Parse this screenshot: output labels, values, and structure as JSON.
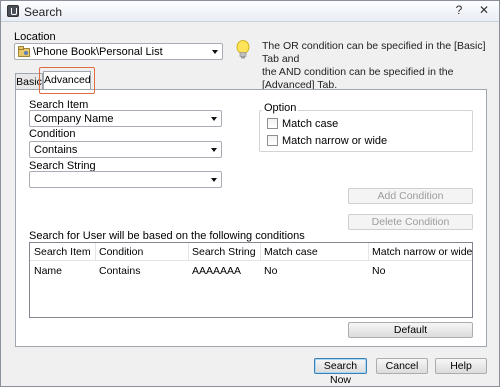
{
  "window": {
    "title": "Search"
  },
  "location": {
    "label": "Location",
    "value": "\\Phone Book\\Personal List",
    "info": [
      "The OR condition can be specified in the [Basic] Tab and",
      "the AND condition can be specified in the [Advanced] Tab."
    ]
  },
  "tabs": [
    {
      "label": "Basic"
    },
    {
      "label": "Advanced"
    }
  ],
  "advanced": {
    "search_item_label": "Search Item",
    "search_item_value": "Company Name",
    "condition_label": "Condition",
    "condition_value": "Contains",
    "search_string_label": "Search String",
    "search_string_value": "",
    "option_label": "Option",
    "match_case_label": "Match case",
    "match_narrow_label": "Match narrow or wide",
    "add_condition": "Add Condition",
    "delete_condition": "Delete Condition",
    "conditions_caption": "Search for User will be based on the following conditions",
    "columns": [
      "Search Item",
      "Condition",
      "Search String",
      "Match case",
      "Match narrow or wide"
    ],
    "rows": [
      [
        "Name",
        "Contains",
        "AAAAAAA",
        "No",
        "No"
      ]
    ],
    "default_button": "Default"
  },
  "footer": {
    "search_now": "Search Now",
    "cancel": "Cancel",
    "help": "Help"
  },
  "icons": {
    "app": "app-icon",
    "location": "folder-tree-icon",
    "info": "lightbulb-icon"
  }
}
